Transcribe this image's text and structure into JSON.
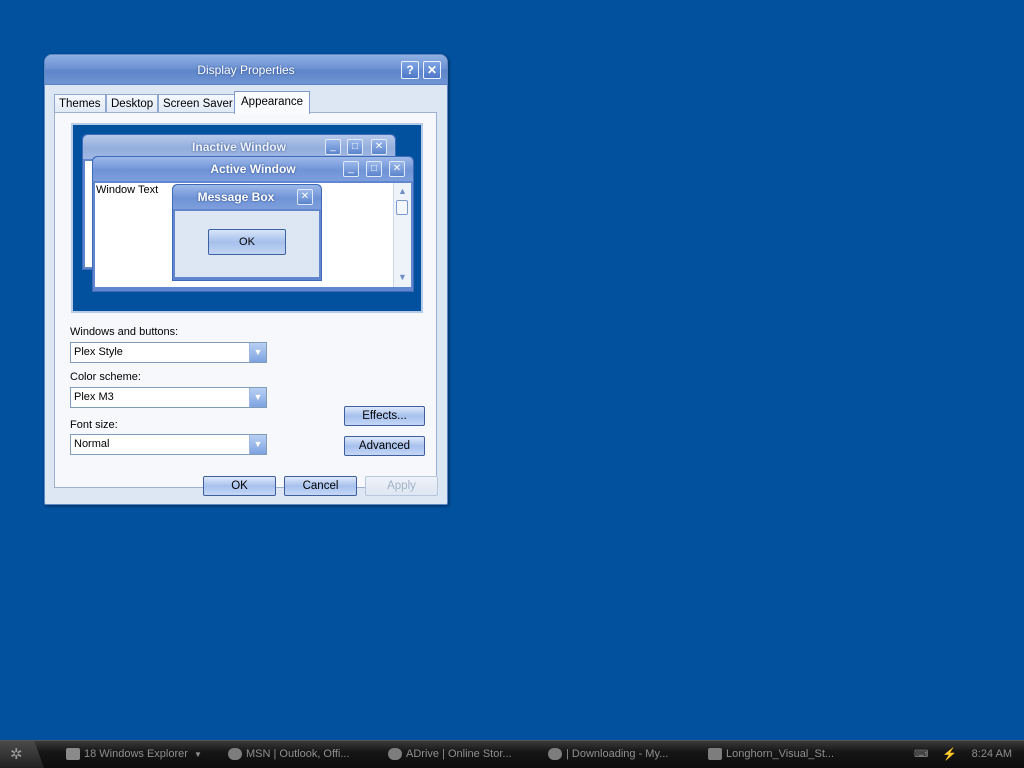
{
  "dialog": {
    "title": "Display Properties",
    "help_button": "?",
    "close_button": "✕",
    "tabs": [
      {
        "label": "Themes"
      },
      {
        "label": "Desktop"
      },
      {
        "label": "Screen Saver"
      },
      {
        "label": "Appearance",
        "active": true
      }
    ],
    "preview": {
      "inactive_title": "Inactive Window",
      "active_title": "Active Window",
      "window_text": "Window Text",
      "message_box_title": "Message Box",
      "message_box_ok": "OK"
    },
    "windows_buttons_label": "Windows and buttons:",
    "windows_buttons_value": "Plex Style",
    "color_scheme_label": "Color scheme:",
    "color_scheme_value": "Plex M3",
    "font_size_label": "Font size:",
    "font_size_value": "Normal",
    "effects_button": "Effects...",
    "advanced_button": "Advanced",
    "ok_button": "OK",
    "cancel_button": "Cancel",
    "apply_button": "Apply"
  },
  "taskbar": {
    "items": [
      {
        "label": "18 Windows Explorer",
        "icon": "folder-icon"
      },
      {
        "label": "MSN | Outlook, Offi...",
        "icon": "ie-icon"
      },
      {
        "label": "ADrive | Online Stor...",
        "icon": "ie-icon"
      },
      {
        "label": "| Downloading - My...",
        "icon": "download-icon"
      },
      {
        "label": "Longhorn_Visual_St...",
        "icon": "image-icon"
      }
    ],
    "clock": "8:24 AM"
  },
  "colors": {
    "desktop": "#02519e",
    "titlebar": "#6e93d3",
    "taskbar": "#161616"
  }
}
